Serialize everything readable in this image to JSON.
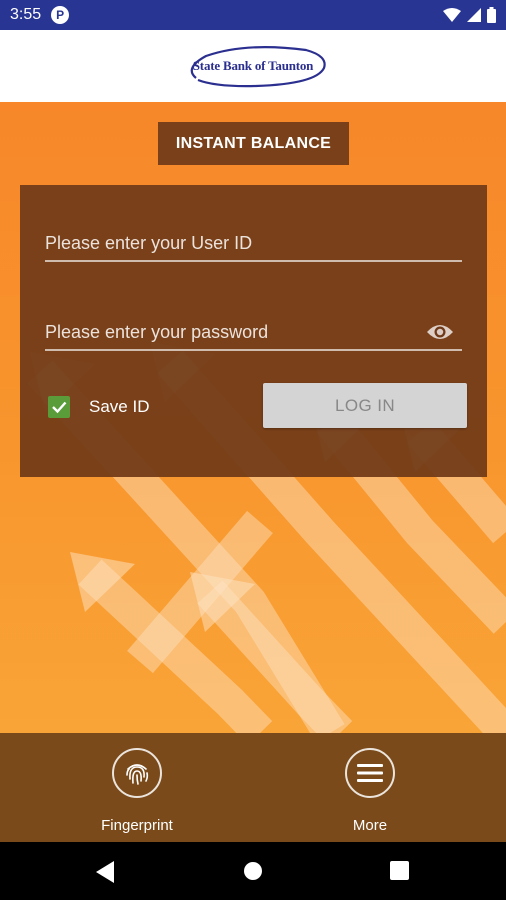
{
  "status_bar": {
    "time": "3:55",
    "app_icon_letter": "P",
    "icons": [
      "wifi-icon",
      "signal-icon",
      "battery-icon"
    ]
  },
  "header": {
    "logo_text": "State Bank of Taunton",
    "logo_color": "#2b2f8f"
  },
  "main": {
    "instant_balance_label": "INSTANT BALANCE",
    "user_id_placeholder": "Please enter your User ID",
    "password_placeholder": "Please enter your password",
    "save_id_label": "Save ID",
    "save_id_checked": true,
    "login_label": "LOG IN"
  },
  "bottom_bar": {
    "items": [
      {
        "label": "Fingerprint",
        "icon": "fingerprint-icon"
      },
      {
        "label": "More",
        "icon": "menu-icon"
      }
    ]
  },
  "nav_bar": {
    "icons": [
      "back-icon",
      "home-icon",
      "recents-icon"
    ]
  },
  "colors": {
    "status_bar": "#283593",
    "background_orange": "#f7872a",
    "card_brown": "#703a18",
    "button_brown": "#7a4019",
    "bottom_bar": "#7a4a1a",
    "checkbox_green": "#5a9b3a"
  }
}
